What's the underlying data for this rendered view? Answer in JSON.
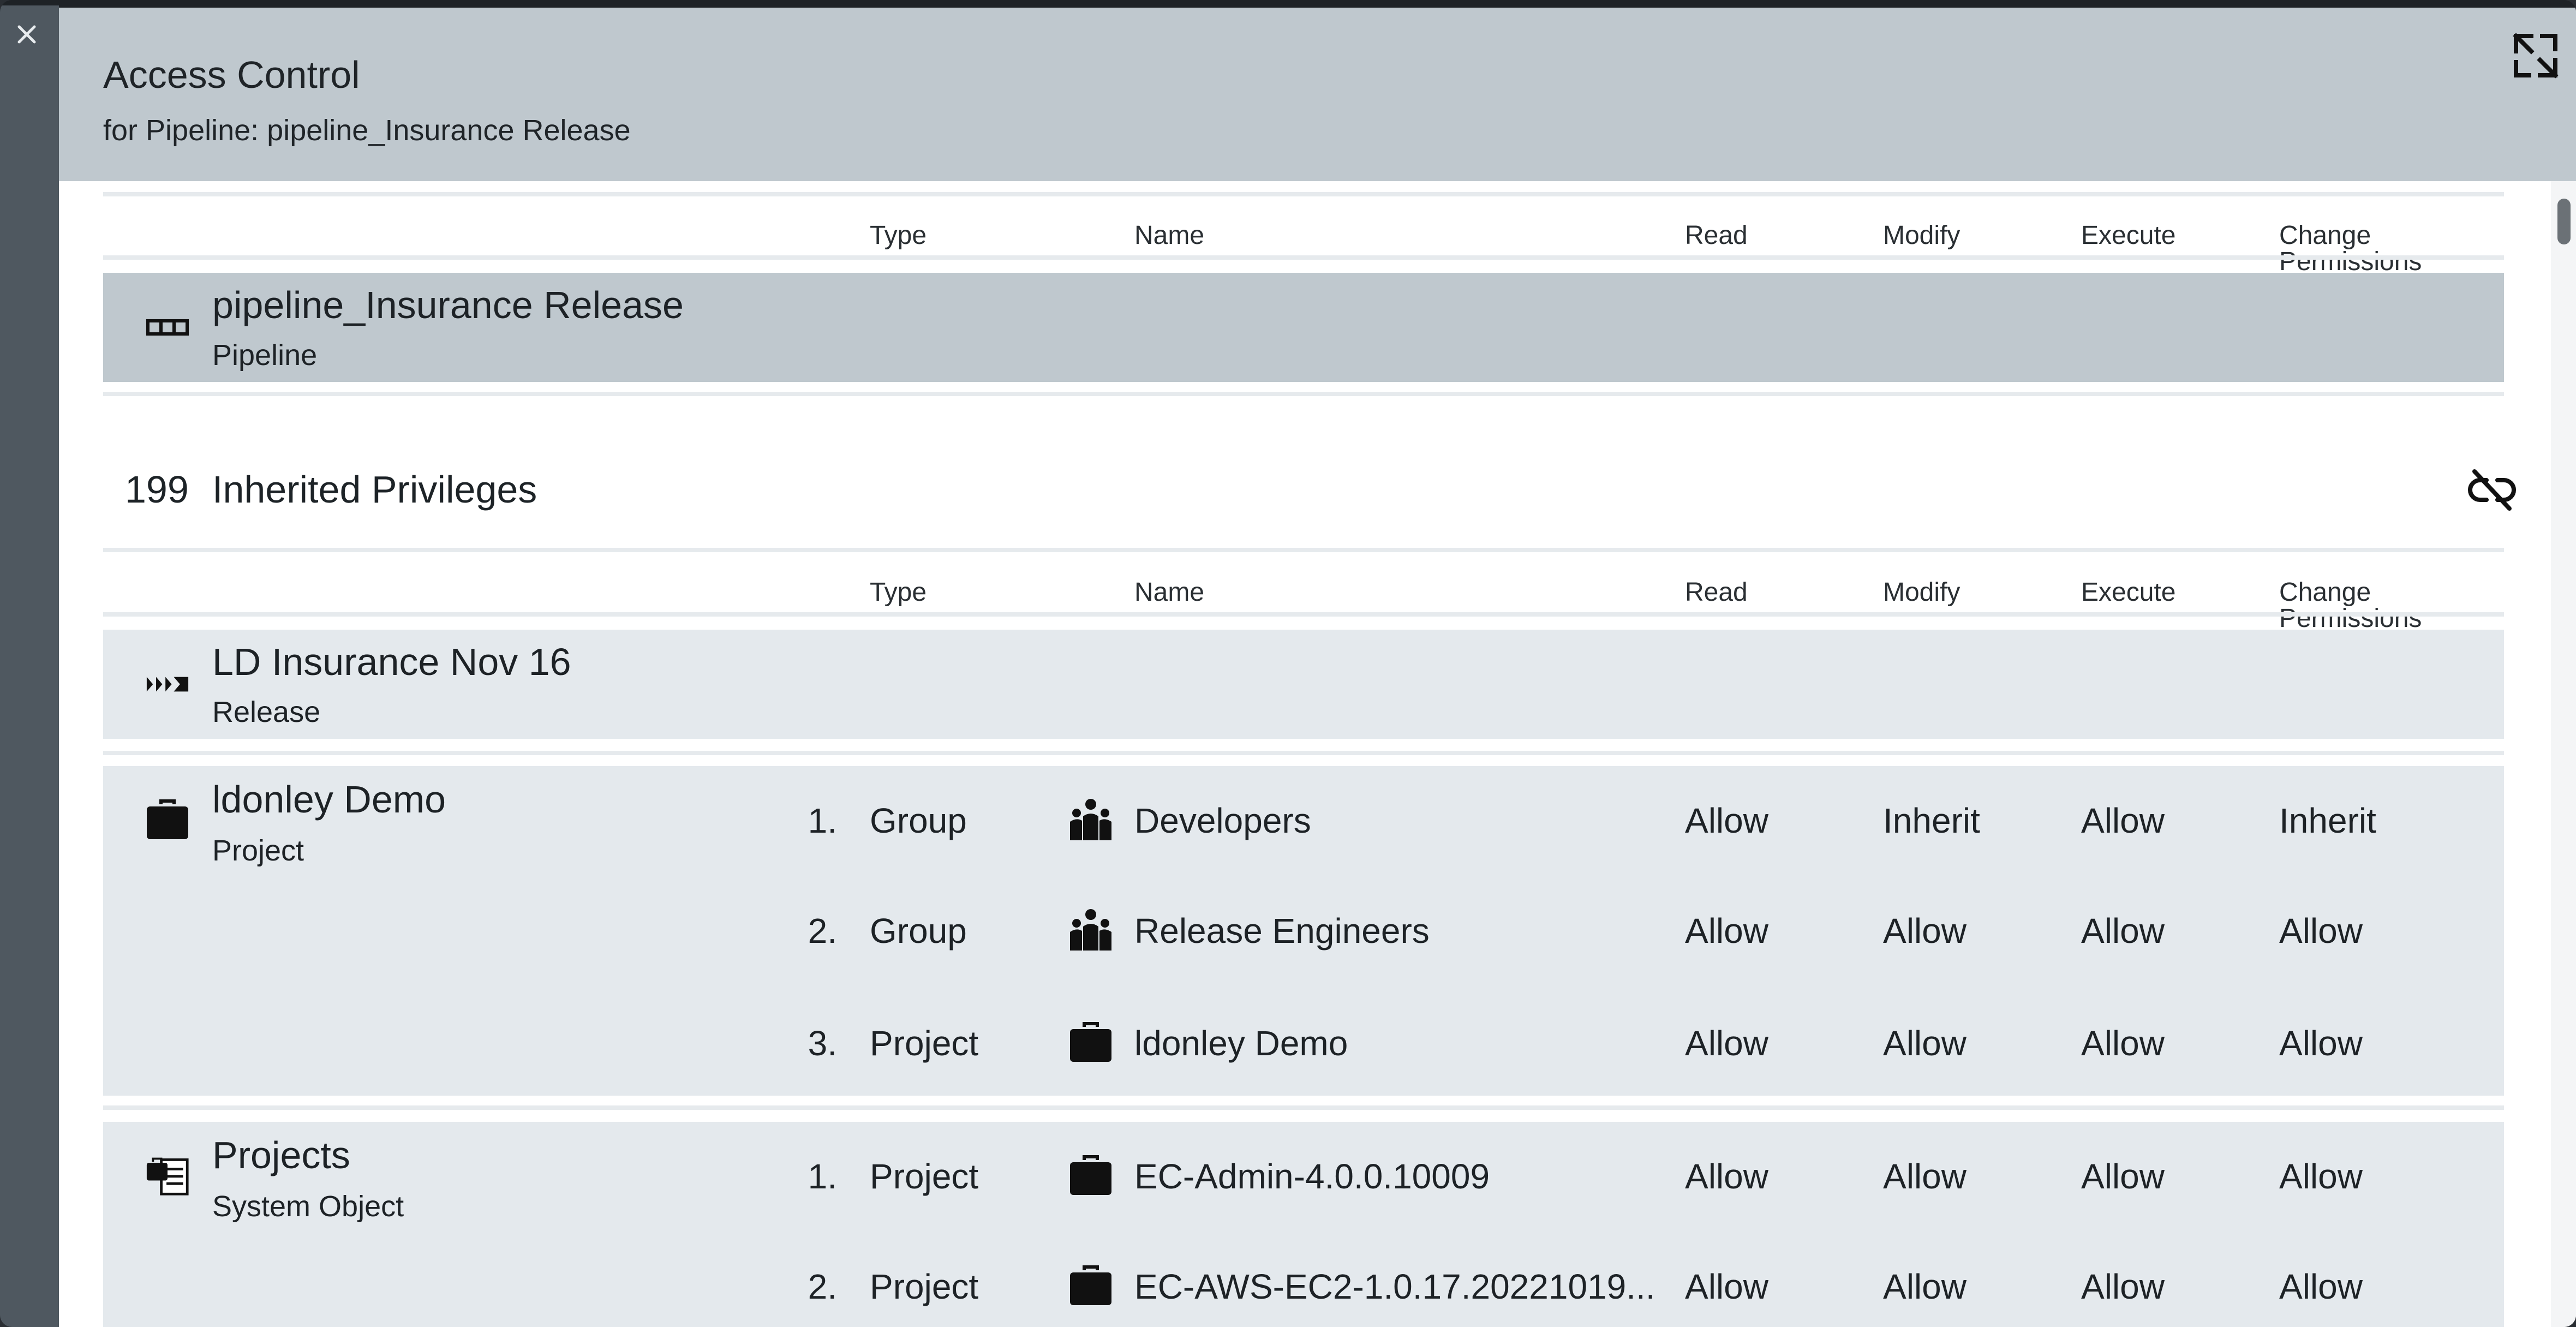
{
  "dialog": {
    "title": "Access Control",
    "subtitle": "for Pipeline: pipeline_Insurance Release"
  },
  "icons": {
    "close": "close-icon",
    "expand": "expand-icon",
    "unlink": "unlink-icon",
    "pipeline": "pipeline-icon",
    "release": "release-icon",
    "project": "briefcase-icon",
    "group": "group-icon",
    "system_object": "system-object-icon"
  },
  "columns": {
    "type": "Type",
    "name": "Name",
    "read": "Read",
    "modify": "Modify",
    "execute": "Execute",
    "change": "Change Permissions"
  },
  "object": {
    "name": "pipeline_Insurance Release",
    "type": "Pipeline"
  },
  "inherited": {
    "count": "199",
    "label": "Inherited Privileges"
  },
  "release": {
    "name": "LD Insurance Nov 16",
    "type": "Release"
  },
  "project": {
    "name": "ldonley Demo",
    "type": "Project",
    "rows": [
      {
        "num": "1.",
        "type": "Group",
        "name": "Developers",
        "read": "Allow",
        "modify": "Inherit",
        "execute": "Allow",
        "change": "Inherit"
      },
      {
        "num": "2.",
        "type": "Group",
        "name": "Release Engineers",
        "read": "Allow",
        "modify": "Allow",
        "execute": "Allow",
        "change": "Allow"
      },
      {
        "num": "3.",
        "type": "Project",
        "name": "ldonley Demo",
        "read": "Allow",
        "modify": "Allow",
        "execute": "Allow",
        "change": "Allow"
      }
    ]
  },
  "projects": {
    "name": "Projects",
    "type": "System Object",
    "rows": [
      {
        "num": "1.",
        "type": "Project",
        "name": "EC-Admin-4.0.0.10009",
        "read": "Allow",
        "modify": "Allow",
        "execute": "Allow",
        "change": "Allow"
      },
      {
        "num": "2.",
        "type": "Project",
        "name": "EC-AWS-EC2-1.0.17.20221019...",
        "read": "Allow",
        "modify": "Allow",
        "execute": "Allow",
        "change": "Allow"
      }
    ]
  },
  "colors": {
    "header_bg": "#bfc8ce",
    "row_bg": "#e4e9ed",
    "side_strip": "#4f5860"
  }
}
